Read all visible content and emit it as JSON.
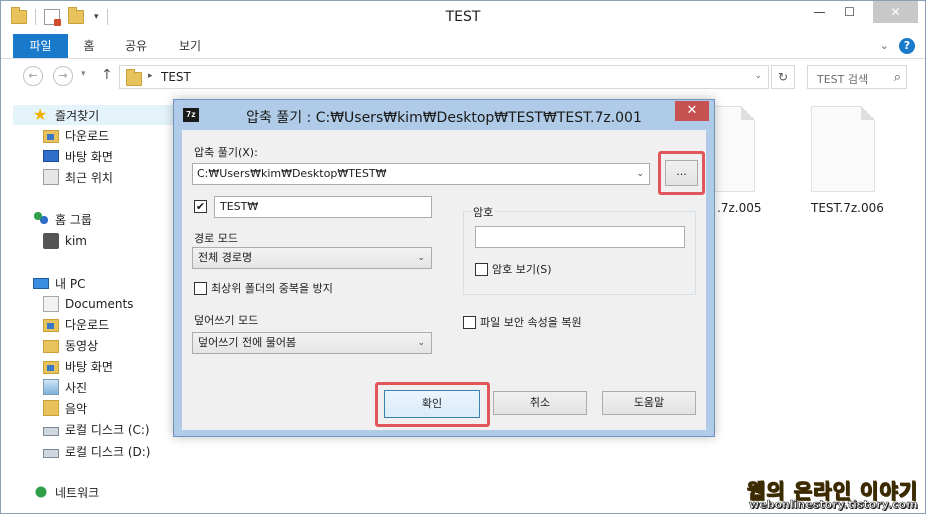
{
  "window": {
    "title": "TEST",
    "controls": {
      "minimize": "—",
      "maximize": "☐",
      "close": "✕"
    }
  },
  "ribbon": {
    "tabs": [
      "파일",
      "홈",
      "공유",
      "보기"
    ],
    "collapse_glyph": "⌄",
    "help_glyph": "?"
  },
  "navbar": {
    "back_glyph": "←",
    "forward_glyph": "→",
    "recent_glyph": "▾",
    "up_glyph": "↑",
    "path_sep": "▸",
    "path": "TEST",
    "path_drop": "⌄",
    "refresh_glyph": "↻",
    "search_placeholder": "TEST 검색",
    "search_icon": "⌕"
  },
  "sidebar": {
    "favorites": {
      "label": "즐겨찾기",
      "icon": "star-icon",
      "items": [
        {
          "label": "다운로드",
          "icon": "downloads-folder-icon"
        },
        {
          "label": "바탕 화면",
          "icon": "desktop-icon"
        },
        {
          "label": "최근 위치",
          "icon": "recent-places-icon"
        }
      ]
    },
    "homegroup": {
      "label": "홈 그룹",
      "icon": "homegroup-icon",
      "items": [
        {
          "label": "kim",
          "icon": "user-icon"
        }
      ]
    },
    "pc": {
      "label": "내 PC",
      "icon": "computer-icon",
      "items": [
        {
          "label": "Documents",
          "icon": "documents-icon"
        },
        {
          "label": "다운로드",
          "icon": "downloads-folder-icon"
        },
        {
          "label": "동영상",
          "icon": "videos-folder-icon"
        },
        {
          "label": "바탕 화면",
          "icon": "desktop-folder-icon"
        },
        {
          "label": "사진",
          "icon": "pictures-folder-icon"
        },
        {
          "label": "음악",
          "icon": "music-folder-icon"
        },
        {
          "label": "로컬 디스크 (C:)",
          "icon": "drive-c-icon"
        },
        {
          "label": "로컬 디스크 (D:)",
          "icon": "drive-d-icon"
        }
      ]
    },
    "network": {
      "label": "네트워크",
      "icon": "network-icon"
    }
  },
  "files": [
    {
      "name": ".7z.005",
      "icon": "file-icon"
    },
    {
      "name": "TEST.7z.006",
      "icon": "file-icon"
    }
  ],
  "dialog": {
    "icon_text": "7z",
    "title": "압축 풀기 : C:₩Users₩kim₩Desktop₩TEST₩TEST.7z.001",
    "close_glyph": "✕",
    "extract_to_label": "압축 풀기(X):",
    "extract_to_value": "C:₩Users₩kim₩Desktop₩TEST₩",
    "browse_label": "...",
    "subfolder_checked": true,
    "subfolder_value": "TEST₩",
    "check_glyph": "✔",
    "path_mode_label": "경로 모드",
    "path_mode_value": "전체 경로명",
    "eliminate_duplication_label": "최상위 폴더의 중복을 방지",
    "overwrite_mode_label": "덮어쓰기 모드",
    "overwrite_mode_value": "덮어쓰기 전에 물어봄",
    "password_group_label": "암호",
    "password_value": "",
    "show_password_label": "암호 보기(S)",
    "restore_security_label": "파일 보안 속성을 복원",
    "dropdown_glyph": "⌄",
    "buttons": {
      "ok": "확인",
      "cancel": "취소",
      "help": "도움말"
    }
  },
  "watermark": {
    "title": "웹의 온라인 이야기",
    "url": "webonlinestory.tistory.com"
  },
  "colors": {
    "accent": "#1979ca",
    "dialog_frame": "#afcbe7",
    "close_red": "#c75050",
    "highlight_red": "#e0565a"
  }
}
